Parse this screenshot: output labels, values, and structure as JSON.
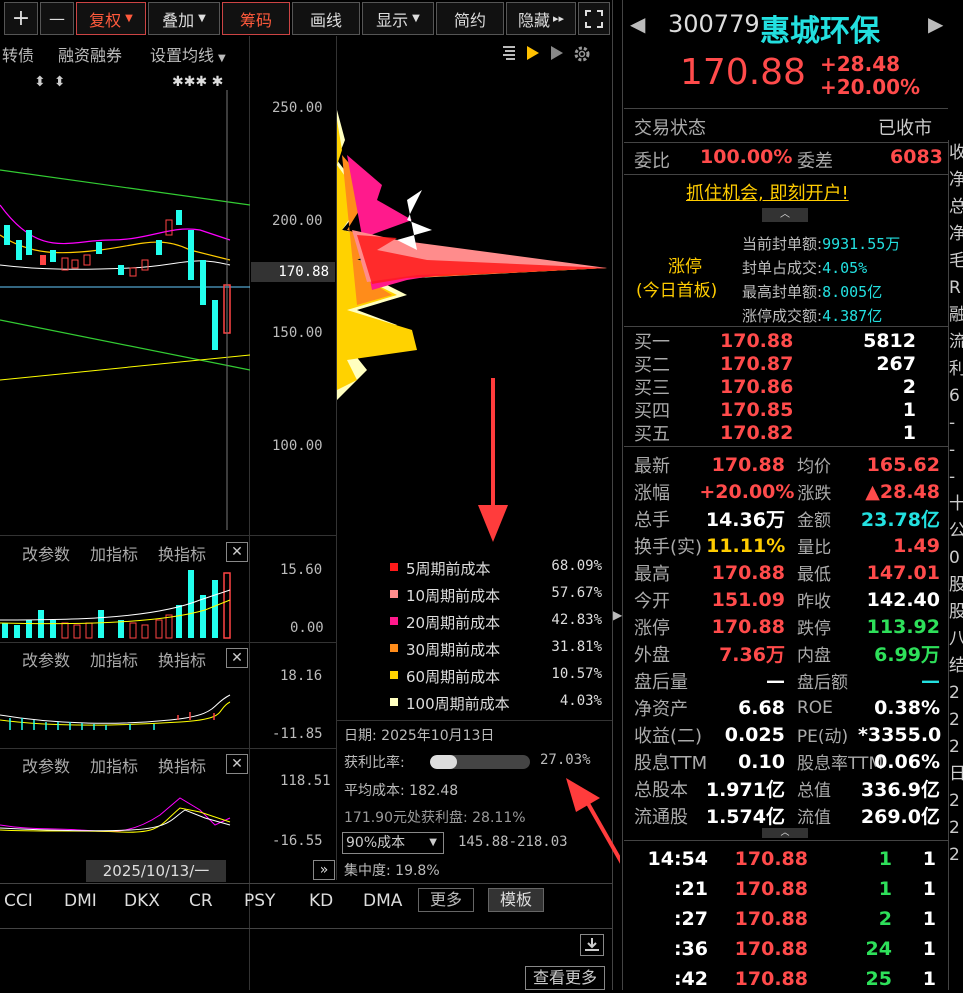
{
  "toolbar": {
    "plus": "+",
    "minus": "—",
    "fuquan": "复权",
    "diejia": "叠加",
    "chouma": "筹码",
    "huaxian": "画线",
    "xianshi": "显示",
    "jianyue": "简约",
    "yincang": "隐藏",
    "more": "▸▸"
  },
  "subbar": {
    "zhuanzhai": "转债",
    "rzrq": "融资融券",
    "ma_setting": "设置均线"
  },
  "price_axis": [
    "250.00",
    "200.00",
    "170.88",
    "150.00",
    "100.00"
  ],
  "panels": {
    "p1": {
      "name": "改参数",
      "add": "加指标",
      "swap": "换指标",
      "hi": "15.60",
      "lo": "0.00"
    },
    "p2": {
      "name": "改参数",
      "add": "加指标",
      "swap": "换指标",
      "hi": "18.16",
      "lo": "-11.85"
    },
    "p3": {
      "name": "改参数",
      "add": "加指标",
      "swap": "换指标",
      "hi": "118.51",
      "lo": "-16.55"
    }
  },
  "date_chip": "2025/10/13/一",
  "legend": [
    {
      "label": "5周期前成本",
      "pct": "68.09%",
      "color": "#ff1a1a"
    },
    {
      "label": "10周期前成本",
      "pct": "57.67%",
      "color": "#ff8c8c"
    },
    {
      "label": "20周期前成本",
      "pct": "42.83%",
      "color": "#ff1a8c"
    },
    {
      "label": "30周期前成本",
      "pct": "31.81%",
      "color": "#ff8c1a"
    },
    {
      "label": "60周期前成本",
      "pct": "10.57%",
      "color": "#ffd200"
    },
    {
      "label": "100周期前成本",
      "pct": "4.03%",
      "color": "#ffffc0"
    }
  ],
  "chip_info": {
    "date": "日期: 2025年10月13日",
    "profit_label": "获利比率:",
    "profit": "27.03%",
    "profit_frac": 0.2703,
    "avg": "平均成本: 182.48",
    "at_price": "171.90元处获利盘: 28.11%",
    "cost_sel": "90%成本",
    "range": "145.88-218.03",
    "conc": "集中度: 19.8%"
  },
  "indicators": [
    "CCI",
    "DMI",
    "DKX",
    "CR",
    "PSY",
    "KD",
    "DMA"
  ],
  "ind_more": "更多",
  "ind_template": "模板",
  "look_more": "查看更多",
  "stock": {
    "code": "300779",
    "name": "惠城环保",
    "price": "170.88",
    "chg": "+28.48",
    "pct": "+20.00%"
  },
  "status": {
    "label": "交易状态",
    "value": "已收市"
  },
  "ratio": {
    "wb_l": "委比",
    "wb": "100.00%",
    "wc_l": "委差",
    "wc": "6083"
  },
  "ad": "抓住机会, 即刻开户!",
  "limit": {
    "title1": "涨停",
    "title2": "(今日首板)",
    "r1l": "当前封单额:",
    "r1": "9931.55万",
    "r2l": "封单占成交:",
    "r2": "4.05%",
    "r3l": "最高封单额:",
    "r3": "8.005亿",
    "r4l": "涨停成交额:",
    "r4": "4.387亿"
  },
  "bids": [
    {
      "l": "买一",
      "p": "170.88",
      "v": "5812"
    },
    {
      "l": "买二",
      "p": "170.87",
      "v": "267"
    },
    {
      "l": "买三",
      "p": "170.86",
      "v": "2"
    },
    {
      "l": "买四",
      "p": "170.85",
      "v": "1"
    },
    {
      "l": "买五",
      "p": "170.82",
      "v": "1"
    }
  ],
  "quote": [
    {
      "l1": "最新",
      "v1": "170.88",
      "c1": "red",
      "l2": "均价",
      "v2": "165.62",
      "c2": "red"
    },
    {
      "l1": "涨幅",
      "v1": "+20.00%",
      "c1": "red",
      "l2": "涨跌",
      "v2": "▲28.48",
      "c2": "red"
    },
    {
      "l1": "总手",
      "v1": "14.36万",
      "c1": "wh",
      "l2": "金额",
      "v2": "23.78亿",
      "c2": "cy"
    },
    {
      "l1": "换手(实)",
      "v1": "11.11%",
      "c1": "yl2",
      "l2": "量比",
      "v2": "1.49",
      "c2": "red"
    },
    {
      "l1": "最高",
      "v1": "170.88",
      "c1": "red",
      "l2": "最低",
      "v2": "147.01",
      "c2": "red"
    },
    {
      "l1": "今开",
      "v1": "151.09",
      "c1": "red",
      "l2": "昨收",
      "v2": "142.40",
      "c2": "wh"
    },
    {
      "l1": "涨停",
      "v1": "170.88",
      "c1": "red",
      "l2": "跌停",
      "v2": "113.92",
      "c2": "grn"
    },
    {
      "l1": "外盘",
      "v1": "7.36万",
      "c1": "red",
      "l2": "内盘",
      "v2": "6.99万",
      "c2": "grn"
    },
    {
      "l1": "盘后量",
      "v1": "—",
      "c1": "wh",
      "l2": "盘后额",
      "v2": "—",
      "c2": "cy"
    },
    {
      "l1": "净资产",
      "v1": "6.68",
      "c1": "wh",
      "l2": "ROE",
      "v2": "0.38%",
      "c2": "wh"
    },
    {
      "l1": "收益(二)",
      "v1": "0.025",
      "c1": "wh",
      "l2": "PE(动)",
      "v2": "*3355.0",
      "c2": "wh"
    },
    {
      "l1": "股息TTM",
      "v1": "0.10",
      "c1": "wh",
      "l2": "股息率TTM",
      "v2": "0.06%",
      "c2": "wh"
    },
    {
      "l1": "总股本",
      "v1": "1.971亿",
      "c1": "wh",
      "l2": "总值",
      "v2": "336.9亿",
      "c2": "wh"
    },
    {
      "l1": "流通股",
      "v1": "1.574亿",
      "c1": "wh",
      "l2": "流值",
      "v2": "269.0亿",
      "c2": "wh"
    }
  ],
  "ticks": [
    {
      "t": "14:54",
      "p": "170.88",
      "v": "1",
      "n": "1"
    },
    {
      "t": ":21",
      "p": "170.88",
      "v": "1",
      "n": "1"
    },
    {
      "t": ":27",
      "p": "170.88",
      "v": "2",
      "n": "1"
    },
    {
      "t": ":36",
      "p": "170.88",
      "v": "24",
      "n": "1"
    },
    {
      "t": ":42",
      "p": "170.88",
      "v": "25",
      "n": "1"
    }
  ],
  "edge": [
    "收",
    "净",
    "总",
    "净",
    "毛",
    "R",
    "融",
    "流",
    "利",
    "6",
    "-",
    "-",
    "-",
    "十",
    "公",
    "0",
    "股",
    "股",
    "八",
    "结",
    "2",
    "2",
    "2",
    "日",
    "2",
    "2",
    "2"
  ]
}
